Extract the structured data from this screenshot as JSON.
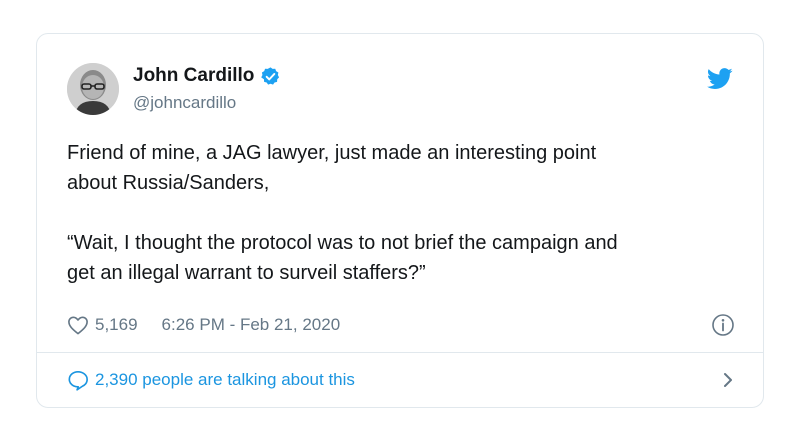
{
  "tweet": {
    "author": {
      "display_name": "John Cardillo",
      "handle": "@johncardillo",
      "verified": true
    },
    "text": "Friend of mine, a JAG lawyer, just made an interesting point\nabout Russia/Sanders,\n\n“Wait, I thought the protocol was to not brief the campaign and\nget an illegal warrant to surveil staffers?”",
    "likes": "5,169",
    "timestamp": "6:26 PM - Feb 21, 2020",
    "talking_label": "2,390 people are talking about this"
  },
  "icons": {
    "brand": "twitter-bird-icon",
    "verified": "verified-badge-icon",
    "like": "heart-icon",
    "info": "info-icon",
    "reply": "speech-bubble-icon",
    "chevron": "chevron-right-icon"
  },
  "colors": {
    "brand_blue": "#1da1f2",
    "link_blue": "#1b95e0",
    "text_primary": "#14171a",
    "text_secondary": "#657786",
    "border": "#e1e8ed"
  }
}
